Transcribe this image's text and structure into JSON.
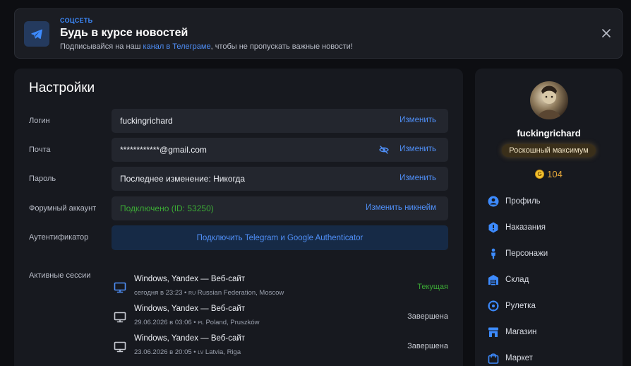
{
  "banner": {
    "tag": "СОЦСЕТЬ",
    "title": "Будь в курсе новостей",
    "subtitle_before": "Подписывайся на наш ",
    "subtitle_link": "канал в Телеграме",
    "subtitle_after": ", чтобы не пропускать важные новости!"
  },
  "settings": {
    "title": "Настройки",
    "rows": [
      {
        "label": "Логин",
        "value": "fuckingrichard",
        "action": "Изменить"
      },
      {
        "label": "Почта",
        "value": "************@gmail.com",
        "action": "Изменить"
      },
      {
        "label": "Пароль",
        "value": "Последнее изменение: Никогда",
        "action": "Изменить"
      },
      {
        "label": "Форумный аккаунт",
        "value": "Подключено (ID: 53250)",
        "action": "Изменить никнейм"
      },
      {
        "label": "Аутентификатор",
        "button": "Подключить Telegram и Google Authenticator"
      }
    ],
    "sessions_label": "Активные сессии",
    "sessions": [
      {
        "title": "Windows, Yandex — Веб-сайт",
        "time": "сегодня в 23:23 • ",
        "cc": "RU",
        "location": " Russian Federation, Moscow",
        "status": "Текущая"
      },
      {
        "title": "Windows, Yandex — Веб-сайт",
        "time": "29.06.2026 в 03:06 • ",
        "cc": "PL",
        "location": " Poland, Pruszków",
        "status": "Завершена"
      },
      {
        "title": "Windows, Yandex — Веб-сайт",
        "time": "23.06.2026 в 20:05 • ",
        "cc": "LV",
        "location": " Latvia, Riga",
        "status": "Завершена"
      }
    ]
  },
  "profile": {
    "username": "fuckingrichard",
    "rank": "Роскошный максимум",
    "coin_symbol": "G",
    "coins": "104",
    "nav": [
      {
        "label": "Профиль",
        "icon": "user-icon"
      },
      {
        "label": "Наказания",
        "icon": "hexagon-alert-icon"
      },
      {
        "label": "Персонажи",
        "icon": "person-icon"
      },
      {
        "label": "Склад",
        "icon": "warehouse-icon"
      },
      {
        "label": "Рулетка",
        "icon": "roulette-icon"
      },
      {
        "label": "Магазин",
        "icon": "store-icon"
      },
      {
        "label": "Маркет",
        "icon": "shopping-bag-icon"
      }
    ]
  },
  "colors": {
    "accent": "#4f8ff7",
    "success": "#3ba935",
    "coin": "#e8a93a",
    "panel": "#17191f",
    "background": "#0d0e12"
  }
}
